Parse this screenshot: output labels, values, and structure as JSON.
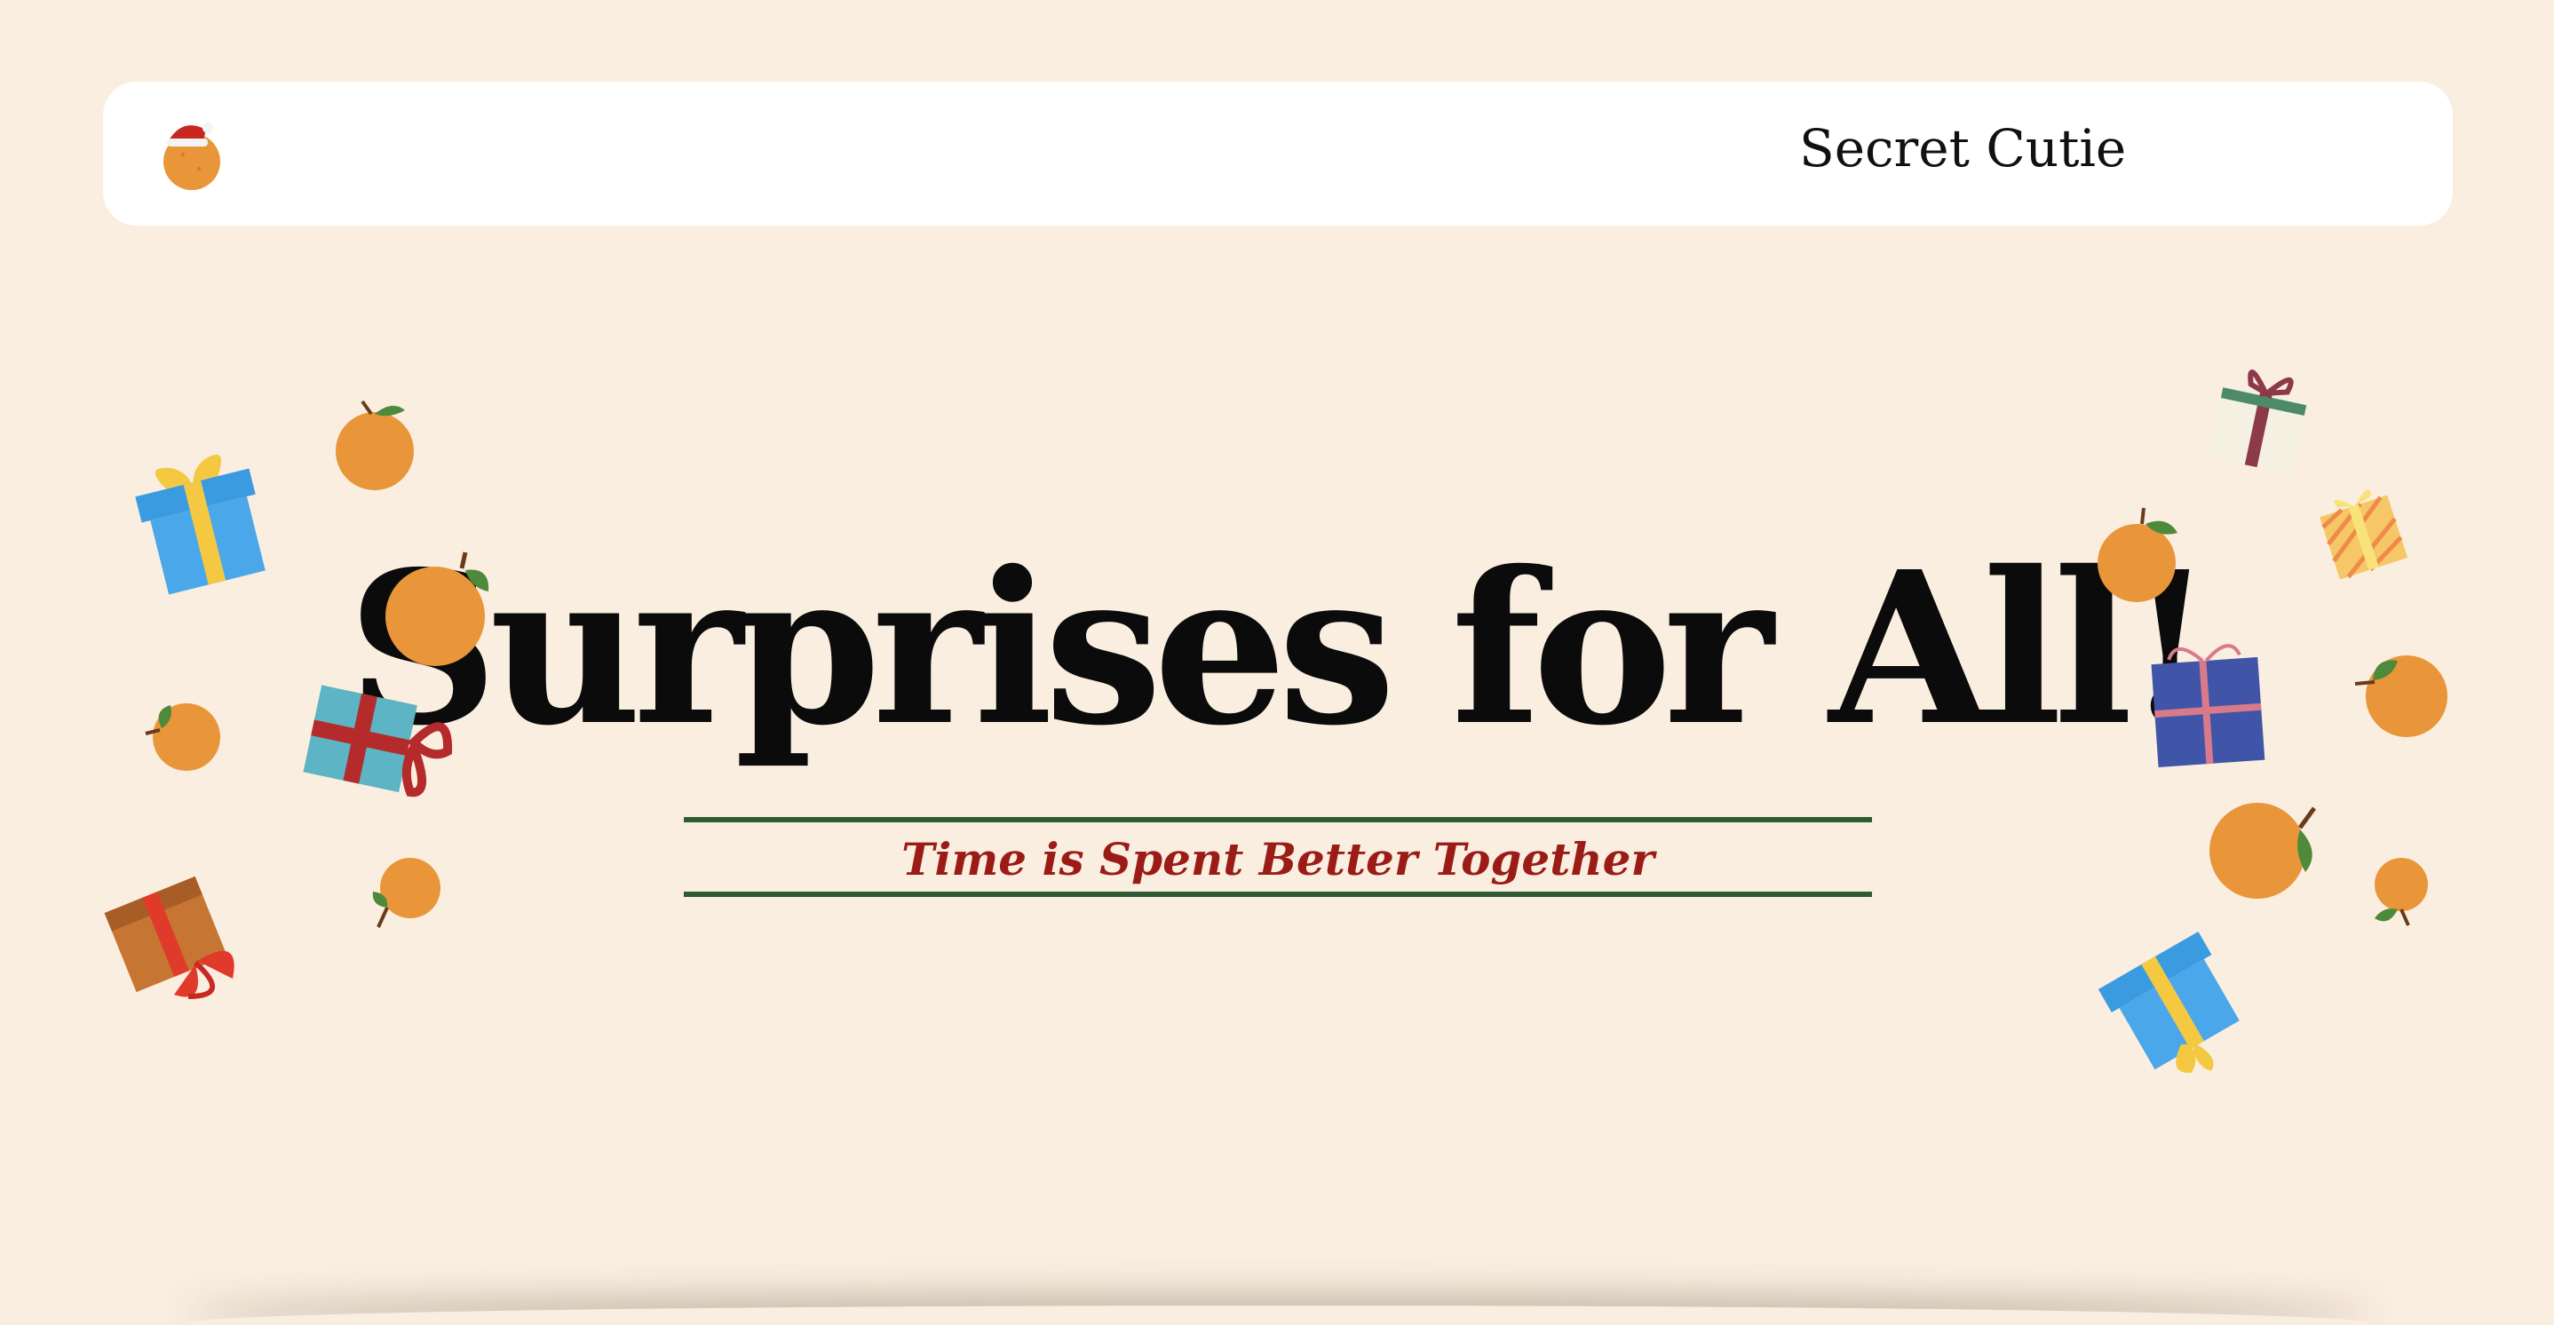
{
  "nav": {
    "logo_icon": "orange-with-santa-hat-icon",
    "brand": "Secret Cutie"
  },
  "hero": {
    "title": "Surprises for All!",
    "tagline": "Time is Spent Better Together"
  },
  "colors": {
    "background": "#faeee0",
    "navbar": "#ffffff",
    "title": "#0b0b0b",
    "tagline": "#9b1c17",
    "rule": "#2f5b34",
    "orange": "#e9953a",
    "leaf": "#4e8a3b"
  },
  "decorations": {
    "left": [
      "gift-icon",
      "orange-icon",
      "orange-icon",
      "orange-icon",
      "gift-icon",
      "orange-icon",
      "gift-icon"
    ],
    "right": [
      "gift-icon",
      "gift-icon",
      "orange-icon",
      "gift-icon",
      "orange-icon",
      "orange-icon",
      "orange-icon",
      "gift-icon"
    ]
  }
}
